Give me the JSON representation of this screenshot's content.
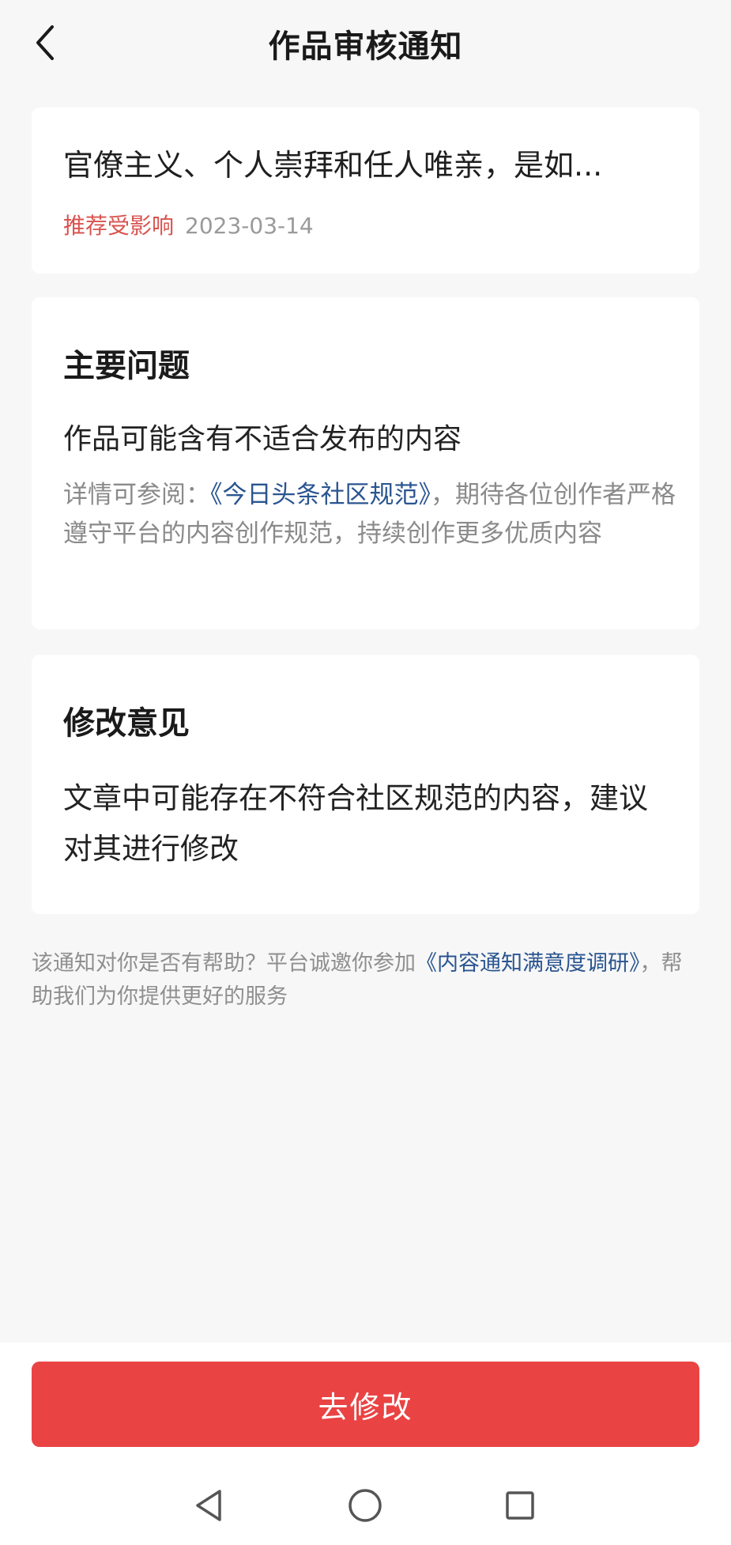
{
  "header": {
    "title": "作品审核通知",
    "back_icon": "chevron-left-icon"
  },
  "article": {
    "title": "官僚主义、个人崇拜和任人唯亲，是如...",
    "status": "推荐受影响",
    "date": "2023-03-14"
  },
  "main_issue": {
    "heading": "主要问题",
    "issue": "作品可能含有不适合发布的内容",
    "detail_prefix": "详情可参阅：",
    "detail_link": "《今日头条社区规范》",
    "detail_suffix": "，期待各位创作者严格遵守平台的内容创作规范，持续创作更多优质内容"
  },
  "suggestion": {
    "heading": "修改意见",
    "text": "文章中可能存在不符合社区规范的内容，建议对其进行修改"
  },
  "survey": {
    "prefix": "该通知对你是否有帮助？平台诚邀你参加",
    "link": "《内容通知满意度调研》",
    "suffix": "，帮助我们为你提供更好的服务"
  },
  "actions": {
    "edit_button": "去修改"
  },
  "colors": {
    "accent": "#ea4343",
    "status": "#d9534f",
    "link": "#2a5590",
    "background": "#f7f7f7"
  },
  "system_nav": {
    "icons": [
      "back-triangle-icon",
      "home-circle-icon",
      "recents-square-icon"
    ]
  }
}
